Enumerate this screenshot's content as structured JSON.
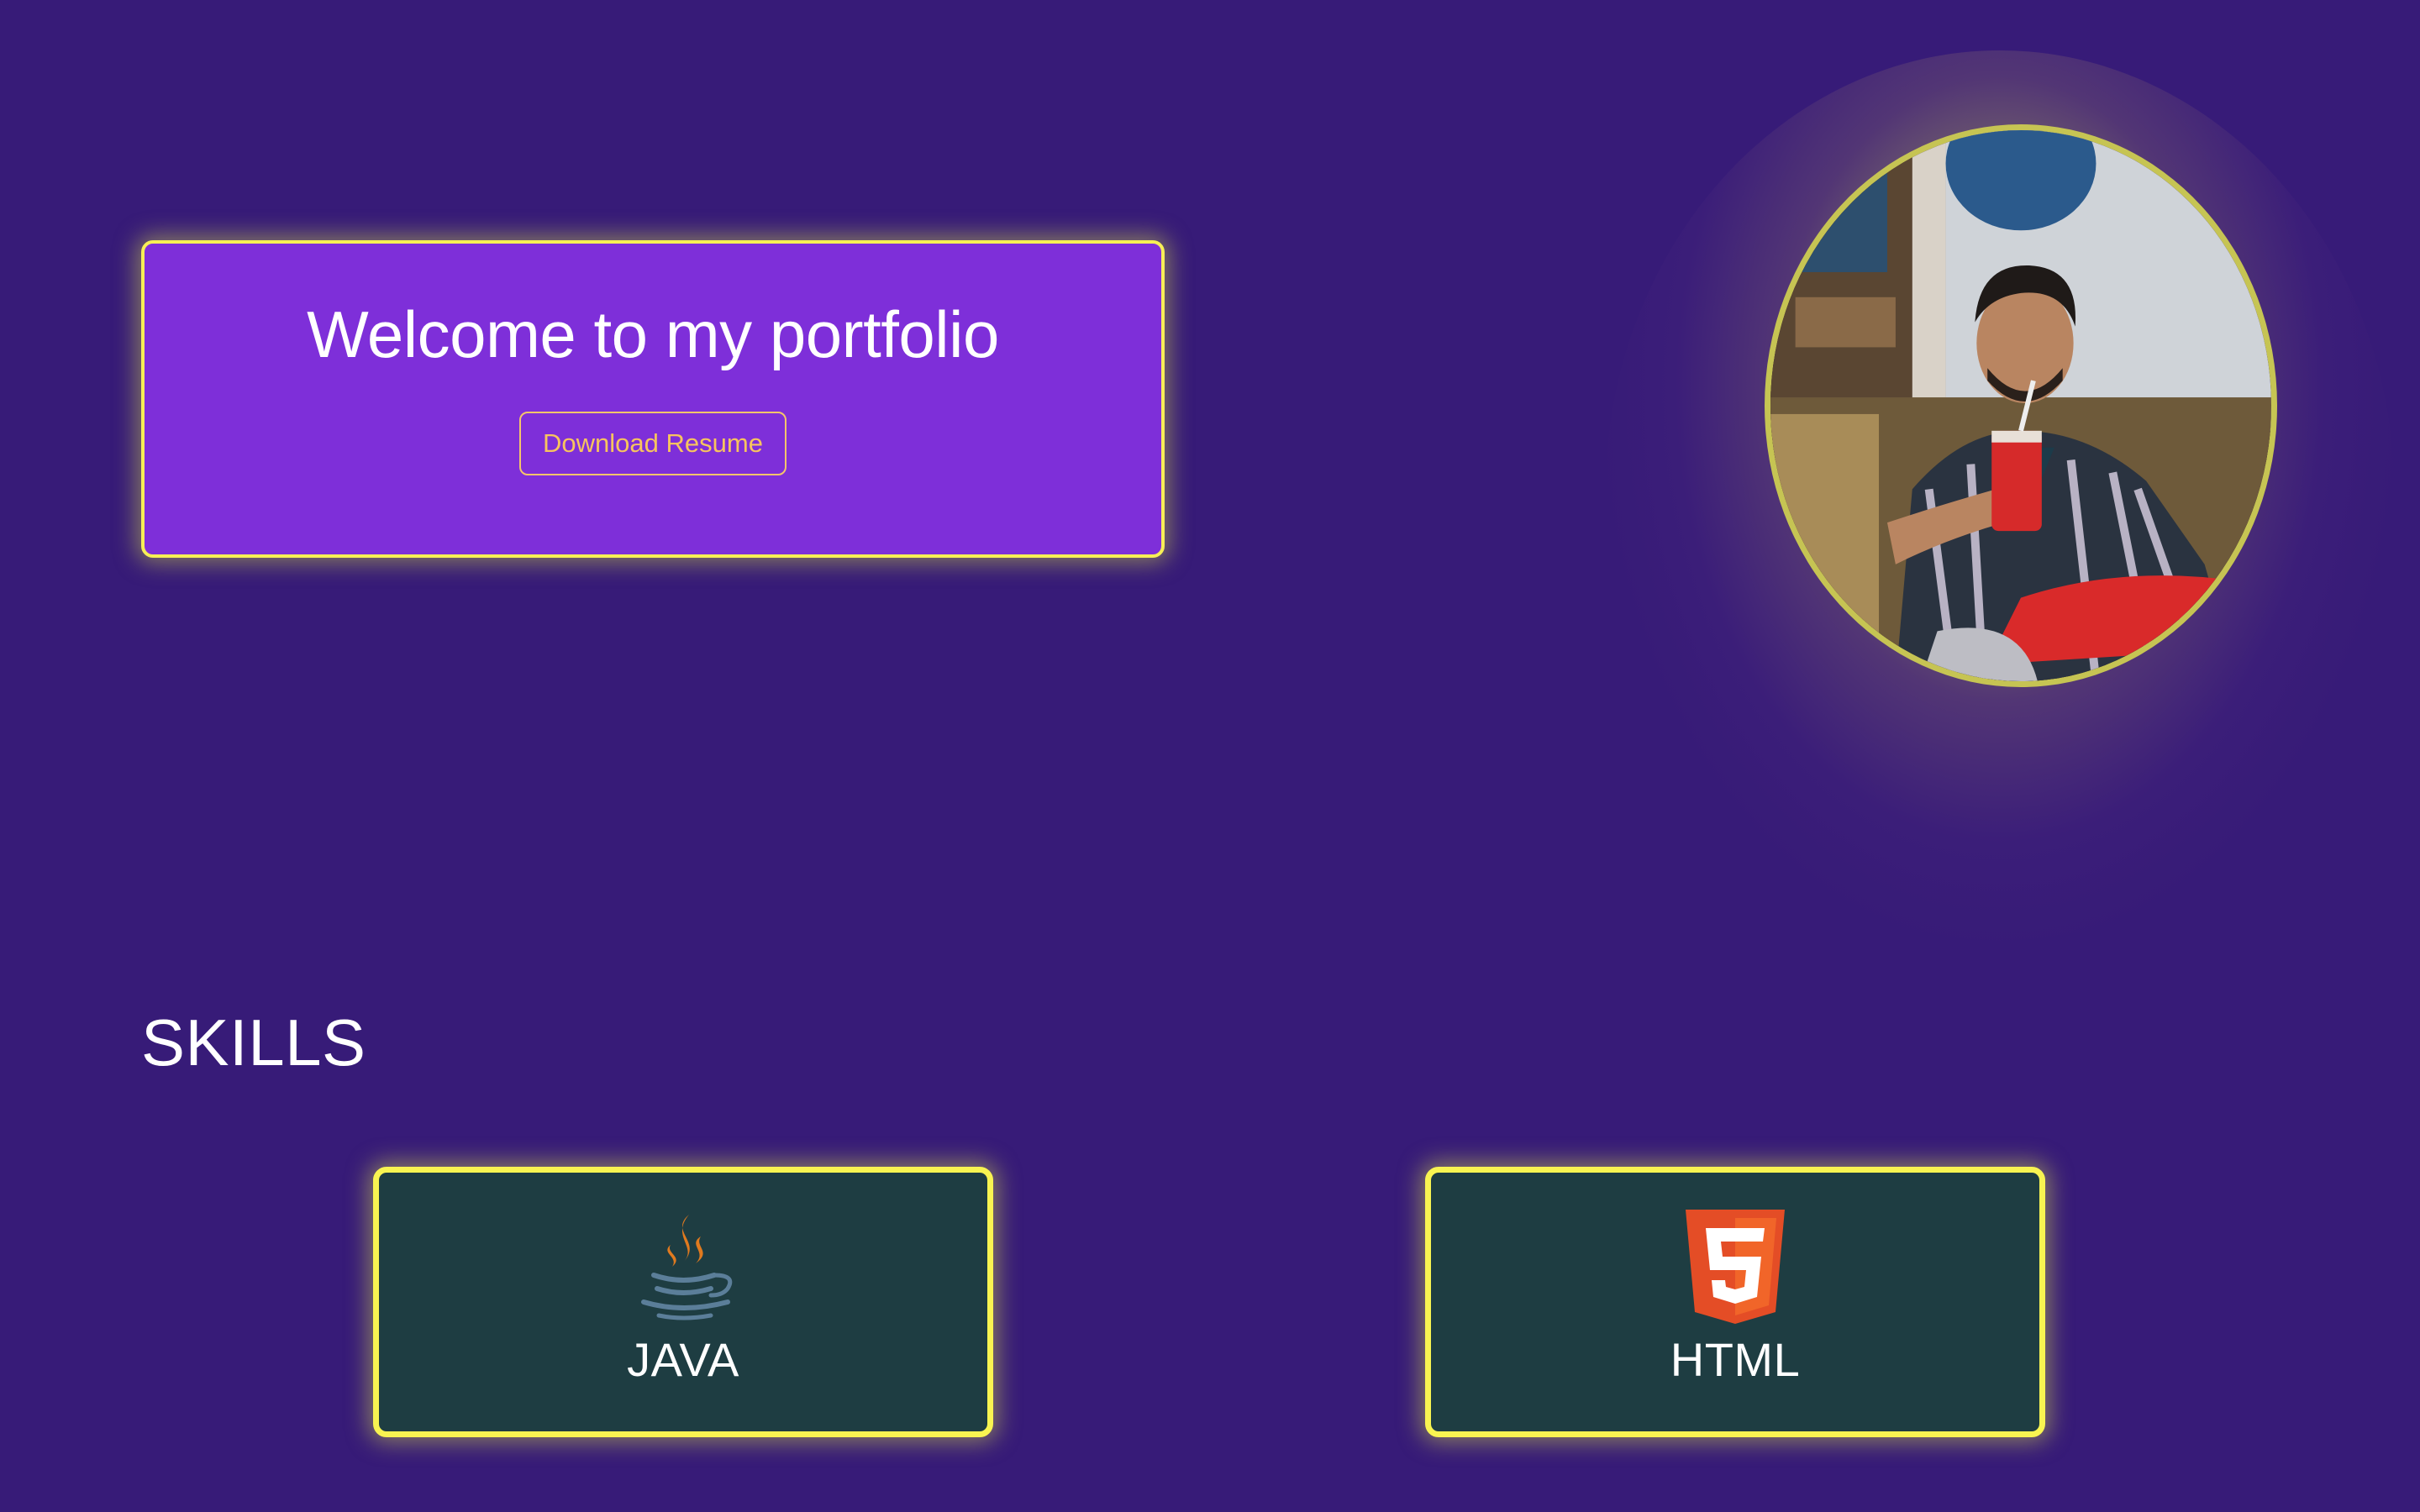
{
  "hero": {
    "title": "Welcome to my portfolio",
    "resume_button_label": "Download Resume"
  },
  "profile": {
    "photo_icon": "profile-photo"
  },
  "skills": {
    "heading": "SKILLS",
    "items": [
      {
        "label": "JAVA",
        "icon": "java-icon"
      },
      {
        "label": "HTML",
        "icon": "html5-icon"
      }
    ]
  },
  "colors": {
    "background": "#371b78",
    "hero_card": "#7e2fd9",
    "accent_yellow": "#f7ef56",
    "button_text": "#f7c45e",
    "skill_card": "#1e3d42"
  }
}
